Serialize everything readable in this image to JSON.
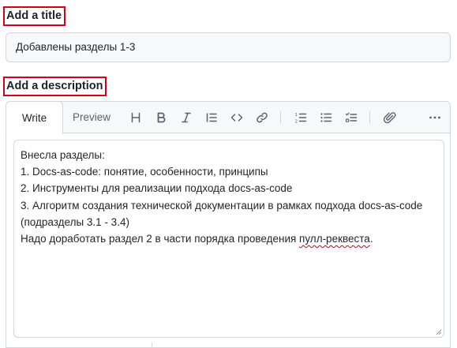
{
  "title_section": {
    "label": "Add a title",
    "value": "Добавлены разделы 1-3"
  },
  "description_section": {
    "label": "Add a description",
    "tabs": [
      {
        "label": "Write",
        "active": true
      },
      {
        "label": "Preview",
        "active": false
      }
    ],
    "toolbar": [
      "heading-icon",
      "bold-icon",
      "italic-icon",
      "quote-icon",
      "code-icon",
      "link-icon",
      "numbered-list-icon",
      "bulleted-list-icon",
      "task-list-icon",
      "attach-icon",
      "more-icon"
    ],
    "body": {
      "line1": "Внесла разделы:",
      "line2": "1. Docs-as-code: понятие, особенности, принципы",
      "line3": "2. Инструменты для реализации подхода docs-as-code",
      "line4": "3. Алгоритм создания технической документации в рамках подхода docs-as-code",
      "line5": "(подразделы 3.1 - 3.4)",
      "line6_before": "Надо доработать раздел 2 в части порядка проведения ",
      "line6_misspelled": "пулл-реквеста",
      "line6_after": "."
    }
  },
  "colors": {
    "highlight_border": "#d0021b",
    "border": "#d0d7de",
    "header_bg": "#f6f8fa",
    "text": "#1f2328",
    "muted": "#59636e"
  }
}
